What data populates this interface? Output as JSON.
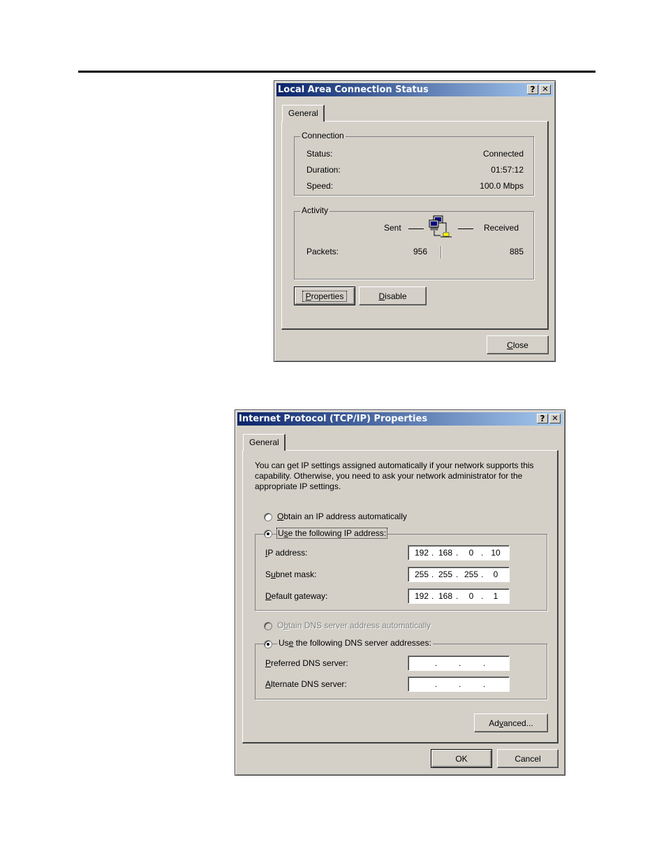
{
  "status_dialog": {
    "title": "Local Area Connection Status",
    "help_btn": "?",
    "close_x": "✕",
    "tab": "General",
    "connection": {
      "label": "Connection",
      "status_label": "Status:",
      "status_value": "Connected",
      "duration_label": "Duration:",
      "duration_value": "01:57:12",
      "speed_label": "Speed:",
      "speed_value": "100.0 Mbps"
    },
    "activity": {
      "label": "Activity",
      "sent_label": "Sent",
      "received_label": "Received",
      "packets_label": "Packets:",
      "packets_sent": "956",
      "packets_received": "885"
    },
    "buttons": {
      "properties": "Properties",
      "properties_u": "P",
      "properties_rest": "roperties",
      "disable_u": "D",
      "disable_rest": "isable",
      "close_u": "C",
      "close_rest": "lose"
    }
  },
  "tcpip_dialog": {
    "title": "Internet Protocol (TCP/IP) Properties",
    "help_btn": "?",
    "close_x": "✕",
    "tab": "General",
    "description": "You can get IP settings assigned automatically if your network supports this capability. Otherwise, you need to ask your network administrator for the appropriate IP settings.",
    "radio_obtain_ip": {
      "u": "O",
      "rest": "btain an IP address automatically"
    },
    "radio_use_ip": {
      "pre": "U",
      "u": "s",
      "rest": "e the following IP address:"
    },
    "ip_address": {
      "u": "I",
      "rest": "P address:",
      "octets": [
        "192",
        "168",
        "0",
        "10"
      ]
    },
    "subnet_mask": {
      "pre": "S",
      "u": "u",
      "rest": "bnet mask:",
      "octets": [
        "255",
        "255",
        "255",
        "0"
      ]
    },
    "default_gateway": {
      "u": "D",
      "rest": "efault gateway:",
      "octets": [
        "192",
        "168",
        "0",
        "1"
      ]
    },
    "radio_obtain_dns": {
      "pre": "O",
      "u": "b",
      "rest": "tain DNS server address automatically"
    },
    "radio_use_dns": {
      "pre": "Us",
      "u": "e",
      "rest": " the following DNS server addresses:"
    },
    "preferred_dns": {
      "u": "P",
      "rest": "referred DNS server:"
    },
    "alternate_dns": {
      "u": "A",
      "rest": "lternate DNS server:"
    },
    "buttons": {
      "advanced_pre": "Ad",
      "advanced_u": "v",
      "advanced_rest": "anced...",
      "ok": "OK",
      "cancel": "Cancel"
    }
  }
}
